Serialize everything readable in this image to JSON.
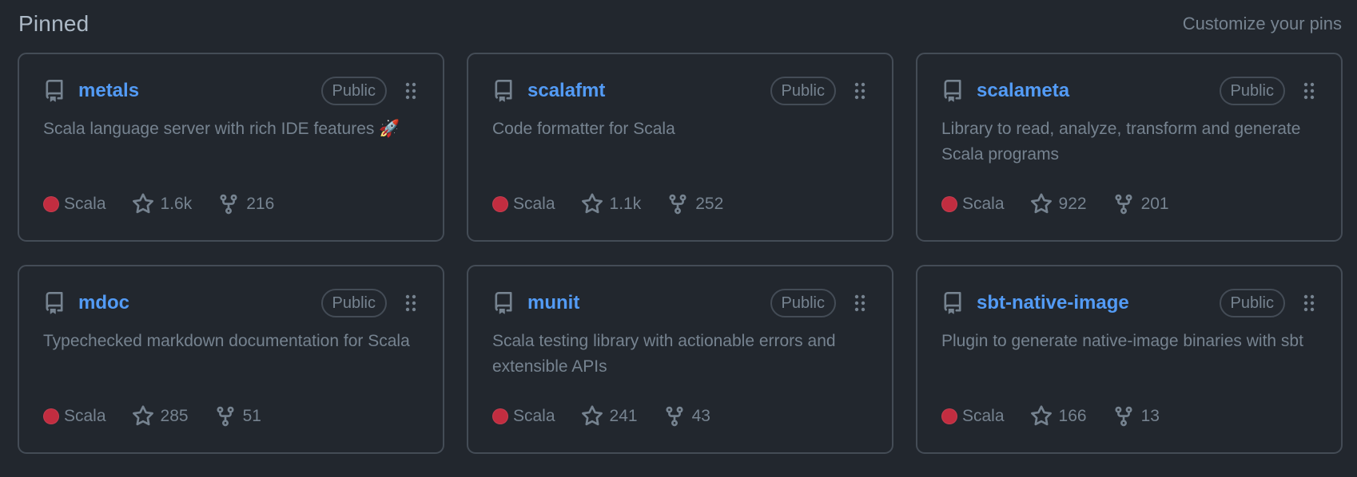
{
  "header": {
    "title": "Pinned",
    "customize_label": "Customize your pins"
  },
  "cards": [
    {
      "name": "metals",
      "badge": "Public",
      "description": "Scala language server with rich IDE features 🚀",
      "language": "Scala",
      "stars": "1.6k",
      "forks": "216"
    },
    {
      "name": "scalafmt",
      "badge": "Public",
      "description": "Code formatter for Scala",
      "language": "Scala",
      "stars": "1.1k",
      "forks": "252"
    },
    {
      "name": "scalameta",
      "badge": "Public",
      "description": "Library to read, analyze, transform and generate Scala programs",
      "language": "Scala",
      "stars": "922",
      "forks": "201"
    },
    {
      "name": "mdoc",
      "badge": "Public",
      "description": "Typechecked markdown documentation for Scala",
      "language": "Scala",
      "stars": "285",
      "forks": "51"
    },
    {
      "name": "munit",
      "badge": "Public",
      "description": "Scala testing library with actionable errors and extensible APIs",
      "language": "Scala",
      "stars": "241",
      "forks": "43"
    },
    {
      "name": "sbt-native-image",
      "badge": "Public",
      "description": "Plugin to generate native-image binaries with sbt",
      "language": "Scala",
      "stars": "166",
      "forks": "13"
    }
  ],
  "colors": {
    "background": "#22272e",
    "border": "#444c56",
    "link": "#539bf5",
    "muted": "#768390",
    "scala": "#c22d40"
  },
  "icons": {
    "repo": "repo-icon",
    "drag": "grabber-icon",
    "star": "star-icon",
    "fork": "fork-icon"
  }
}
